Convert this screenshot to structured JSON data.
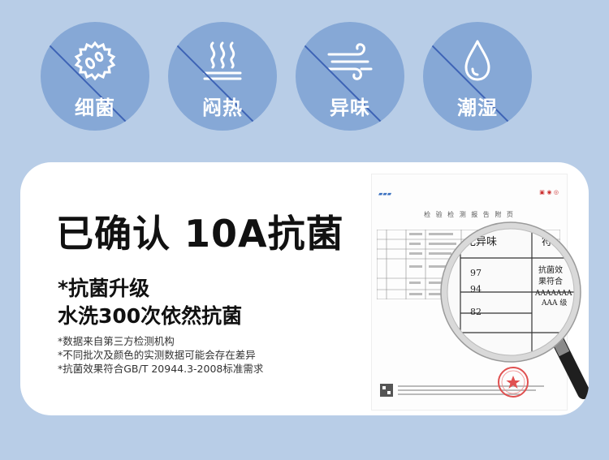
{
  "icons": [
    {
      "label": "细菌",
      "icon": "bacteria-icon"
    },
    {
      "label": "闷热",
      "icon": "heat-icon"
    },
    {
      "label": "异味",
      "icon": "odor-wind-icon"
    },
    {
      "label": "潮湿",
      "icon": "water-drop-icon"
    }
  ],
  "card": {
    "headline": "已确认 10A抗菌",
    "sub1": "*抗菌升级",
    "sub2": "水洗300次依然抗菌",
    "notes": [
      "*数据来自第三方检测机构",
      "*不同批次及颜色的实测数据可能会存在差异",
      "*抗菌效果符合GB/T 20944.3-2008标准需求"
    ]
  },
  "report": {
    "title": "检 验 检 测 报 告 附 页",
    "zoom": {
      "col1_header": "无异味",
      "col2_header": "符合",
      "values": [
        "97",
        "94",
        "82"
      ],
      "verdict_lines": [
        "抗菌效",
        "果符合",
        "AAAAAAA",
        "AAA 级"
      ]
    }
  },
  "colors": {
    "background": "#b8cde7",
    "badge": "#86a8d6",
    "card": "#ffffff",
    "slash": "#3d63b5"
  }
}
